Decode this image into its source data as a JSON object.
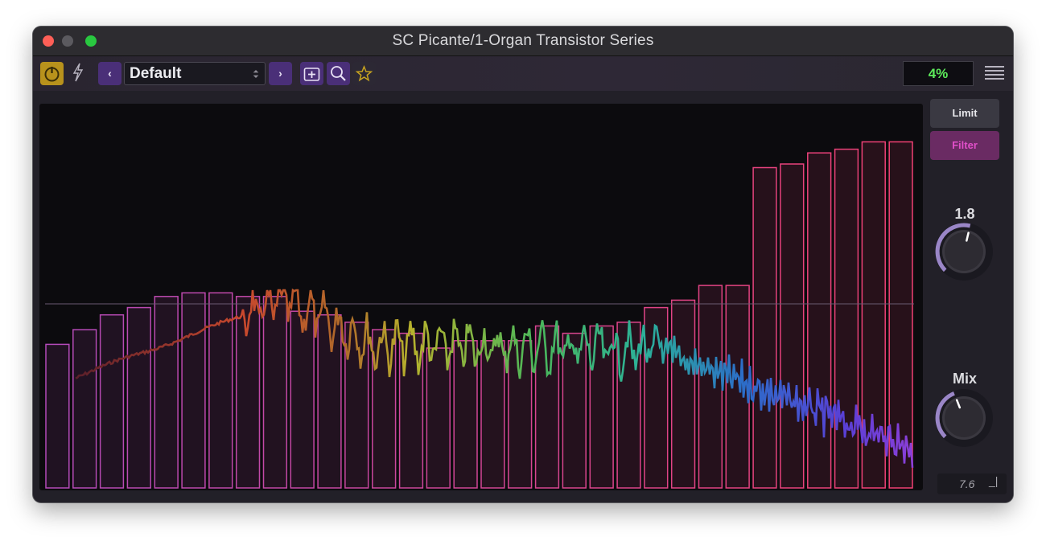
{
  "window": {
    "title": "SC Picante/1-Organ Transistor Series"
  },
  "toolbar": {
    "preset_name": "Default",
    "prev_label": "‹",
    "next_label": "›",
    "cpu_load": "4%"
  },
  "side": {
    "mode_limit": "Limit",
    "mode_filter": "Filter",
    "knob1_value": "1.8",
    "knob1_level": 0.55,
    "knob2_label": "Mix",
    "knob2_level": 0.42,
    "version": "7.6",
    "resize_glyph": "_|"
  },
  "colors": {
    "accent_purple": "#4a2f78",
    "power_gold": "#b8921c",
    "cpu_green": "#5dea5b",
    "filter_pink": "#e14fc9"
  },
  "spectrum": {
    "bands": 31,
    "band_levels": [
      0.39,
      0.43,
      0.47,
      0.49,
      0.52,
      0.53,
      0.53,
      0.52,
      0.52,
      0.48,
      0.47,
      0.45,
      0.43,
      0.42,
      0.38,
      0.4,
      0.4,
      0.4,
      0.44,
      0.42,
      0.44,
      0.45,
      0.49,
      0.51,
      0.55,
      0.55,
      0.87,
      0.88,
      0.91,
      0.92,
      0.94,
      0.94
    ],
    "threshold_level": 0.5
  }
}
